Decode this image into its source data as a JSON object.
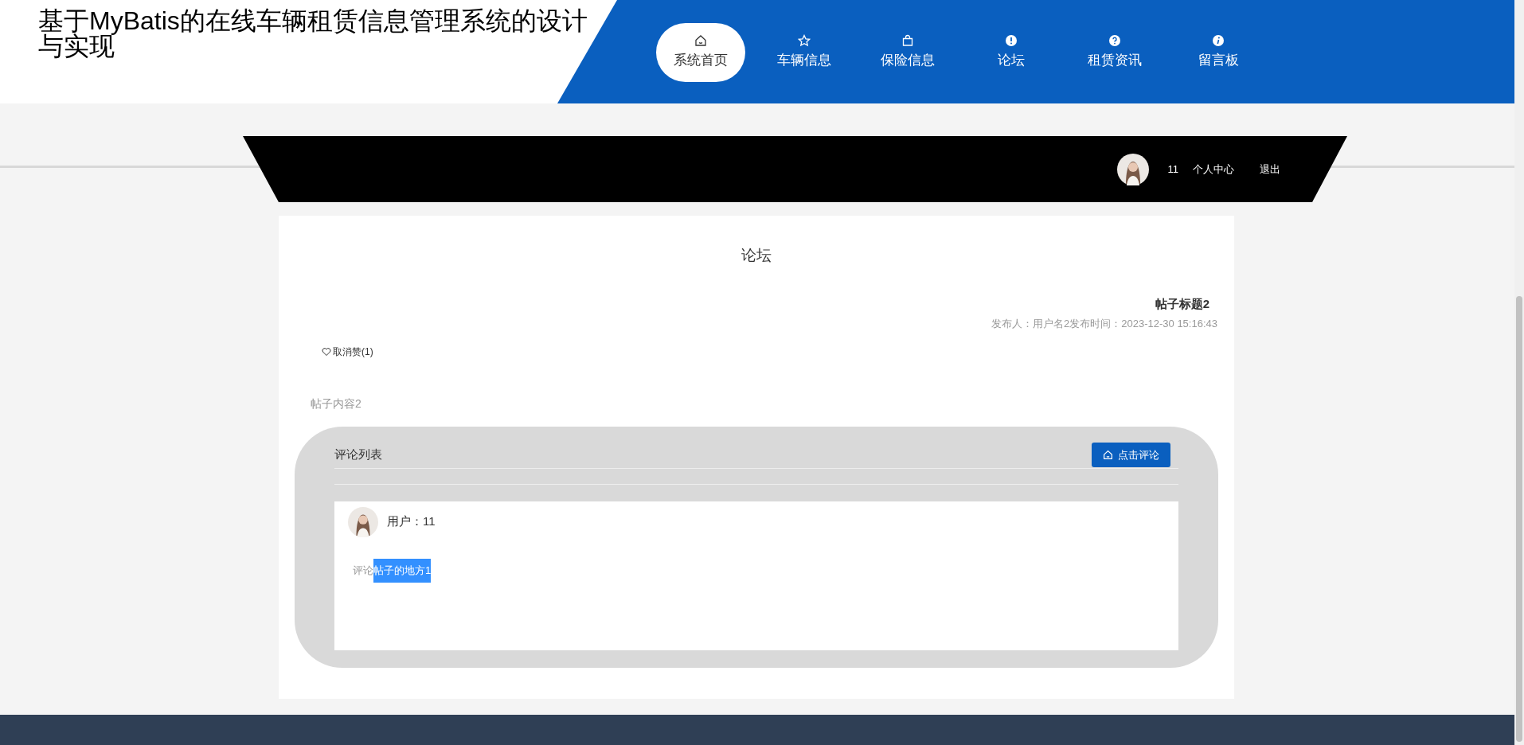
{
  "site_title": "基于MyBatis的在线车辆租赁信息管理系统的设计与实现",
  "nav": [
    {
      "label": "系统首页",
      "selected": true
    },
    {
      "label": "车辆信息",
      "selected": false
    },
    {
      "label": "保险信息",
      "selected": false
    },
    {
      "label": "论坛",
      "selected": false
    },
    {
      "label": "租赁资讯",
      "selected": false
    },
    {
      "label": "留言板",
      "selected": false
    }
  ],
  "user_bar": {
    "username": "11",
    "links": [
      "个人中心",
      "退出"
    ]
  },
  "page_title": "论坛",
  "post": {
    "title": "帖子标题2",
    "meta": "发布人：用户名2发布时间：2023-12-30 15:16:43",
    "like_button": "取消赞(1)",
    "content": "帖子内容2"
  },
  "comments": {
    "title": "评论列表",
    "add_button": "点击评论",
    "items": [
      {
        "user": "用户：11",
        "text": "评论",
        "selected_text": "帖子的地方1"
      }
    ]
  }
}
